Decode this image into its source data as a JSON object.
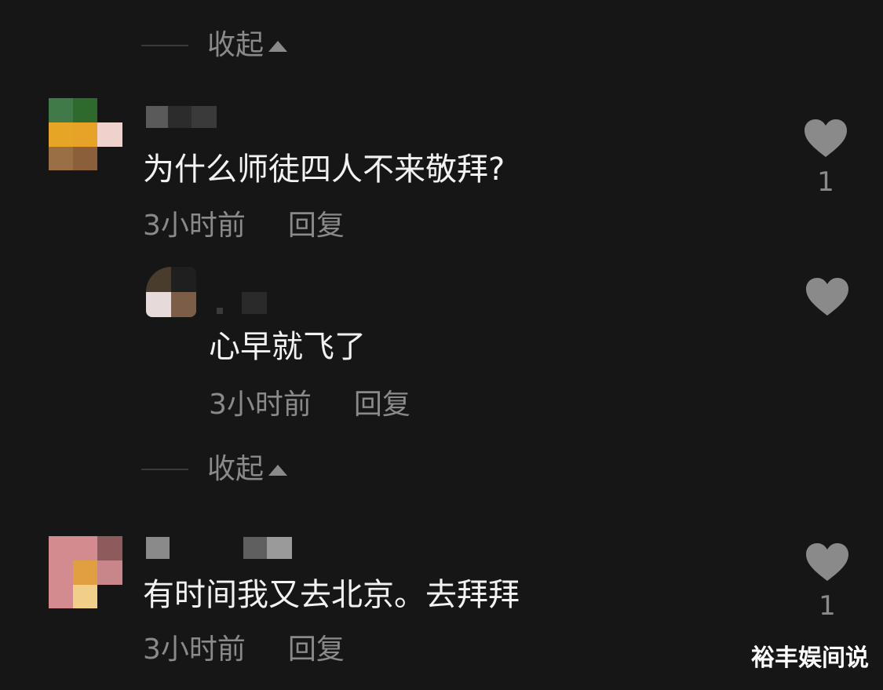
{
  "collapse_label": "收起",
  "comments": [
    {
      "text": "为什么师徒四人不来敬拜?",
      "time": "3小时前",
      "reply": "回复",
      "likes": "1"
    },
    {
      "text": "心早就飞了",
      "time": "3小时前",
      "reply": "回复",
      "likes": ""
    },
    {
      "text": "有时间我又去北京。去拜拜",
      "time": "3小时前",
      "reply": "回复",
      "likes": "1"
    }
  ],
  "watermark": "裕丰娱间说",
  "icons": {
    "collapse": "triangle-up-icon",
    "like": "heart-icon"
  },
  "colors": {
    "background": "#161616",
    "primary_text": "#f2f2f2",
    "secondary_text": "#8a8a8a",
    "heart": "#8a8a8a"
  }
}
